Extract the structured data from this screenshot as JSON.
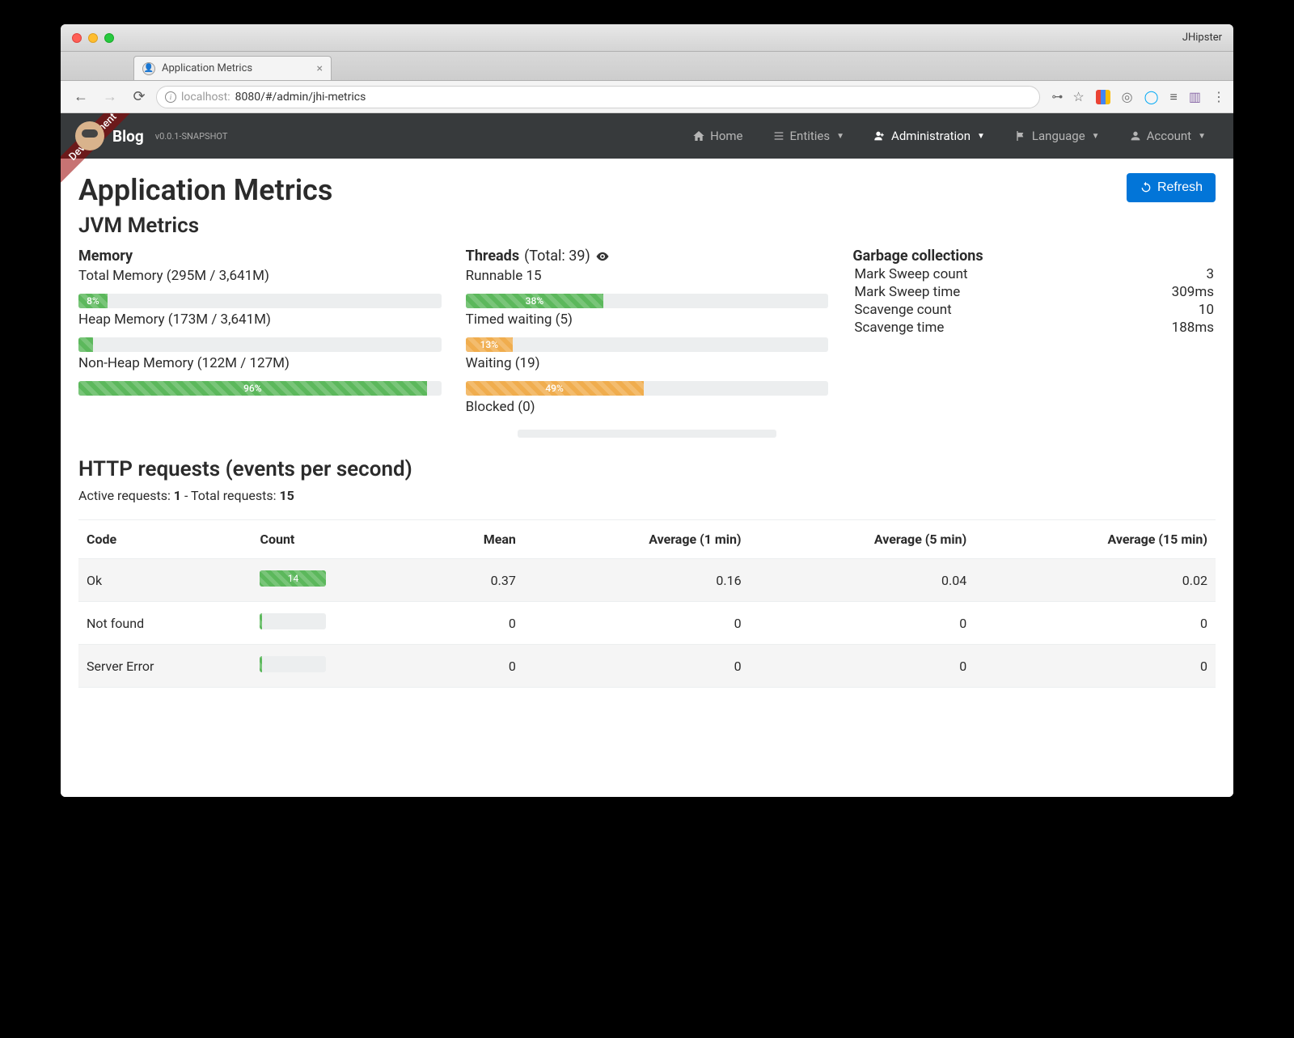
{
  "browser": {
    "os_title": "JHipster",
    "tab_title": "Application Metrics",
    "url_info_host": "localhost:",
    "url_port_path": "8080/#/admin/jhi-metrics"
  },
  "ribbon": "Development",
  "navbar": {
    "brand": "Blog",
    "version": "v0.0.1-SNAPSHOT",
    "links": {
      "home": "Home",
      "entities": "Entities",
      "administration": "Administration",
      "language": "Language",
      "account": "Account"
    }
  },
  "page": {
    "title": "Application Metrics",
    "refresh": "Refresh"
  },
  "jvm": {
    "section": "JVM Metrics",
    "memory": {
      "heading": "Memory",
      "total": "Total Memory (295M / 3,641M)",
      "total_pct": "8%",
      "total_pct_val": 8,
      "heap": "Heap Memory (173M / 3,641M)",
      "heap_pct_val": 4,
      "nonheap": "Non-Heap Memory (122M / 127M)",
      "nonheap_pct": "96%",
      "nonheap_pct_val": 96
    },
    "threads": {
      "heading": "Threads",
      "total_label": "(Total: 39)",
      "runnable": "Runnable 15",
      "runnable_pct": "38%",
      "runnable_pct_val": 38,
      "timed": "Timed waiting (5)",
      "timed_pct": "13%",
      "timed_pct_val": 13,
      "waiting": "Waiting (19)",
      "waiting_pct": "49%",
      "waiting_pct_val": 49,
      "blocked": "Blocked (0)"
    },
    "gc": {
      "heading": "Garbage collections",
      "rows": [
        {
          "label": "Mark Sweep count",
          "value": "3"
        },
        {
          "label": "Mark Sweep time",
          "value": "309ms"
        },
        {
          "label": "Scavenge count",
          "value": "10"
        },
        {
          "label": "Scavenge time",
          "value": "188ms"
        }
      ]
    }
  },
  "http": {
    "title": "HTTP requests (events per second)",
    "active_label": "Active requests:",
    "active_value": "1",
    "sep": " - ",
    "total_label": "Total requests:",
    "total_value": "15",
    "headers": {
      "code": "Code",
      "count": "Count",
      "mean": "Mean",
      "avg1": "Average (1 min)",
      "avg5": "Average (5 min)",
      "avg15": "Average (15 min)"
    },
    "rows": [
      {
        "code": "Ok",
        "count": "14",
        "count_pct": 100,
        "mean": "0.37",
        "a1": "0.16",
        "a5": "0.04",
        "a15": "0.02"
      },
      {
        "code": "Not found",
        "count": "0",
        "count_pct": 3,
        "mean": "0",
        "a1": "0",
        "a5": "0",
        "a15": "0"
      },
      {
        "code": "Server Error",
        "count": "0",
        "count_pct": 3,
        "mean": "0",
        "a1": "0",
        "a5": "0",
        "a15": "0"
      }
    ]
  }
}
